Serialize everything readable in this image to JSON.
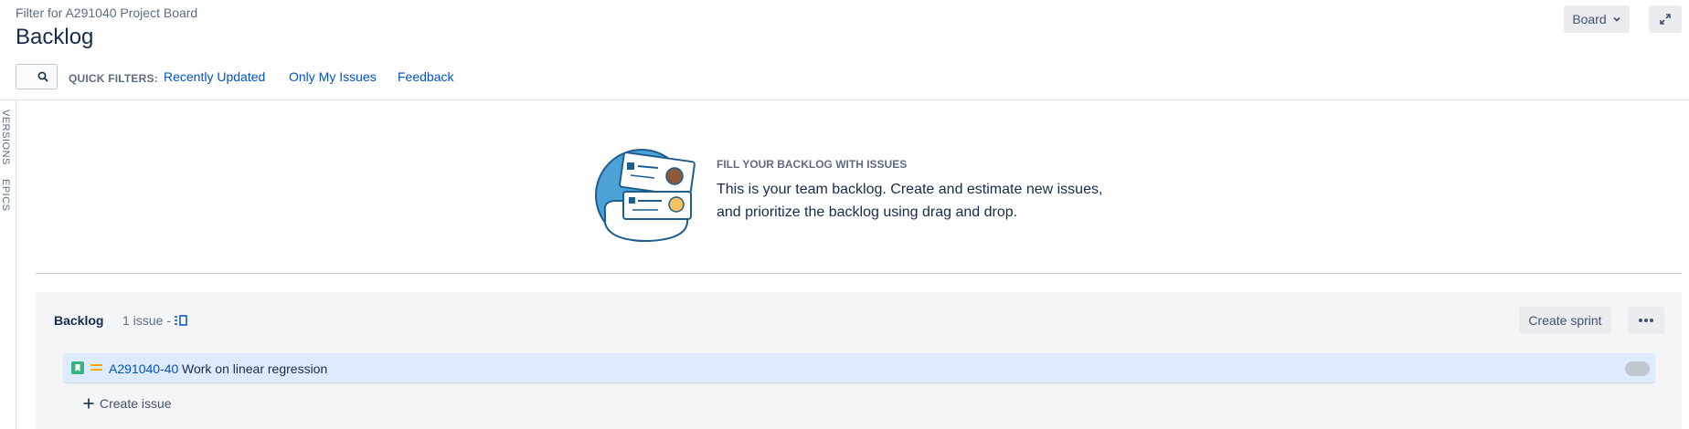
{
  "header": {
    "board_subtitle": "Filter for A291040 Project Board",
    "page_title": "Backlog",
    "board_button_label": "Board",
    "board_icon": "chevron-down-icon",
    "expand_icon": "expand-icon"
  },
  "quick_filters": {
    "label": "QUICK FILTERS:",
    "items": [
      "Recently Updated",
      "Only My Issues",
      "Feedback"
    ],
    "search_icon": "search-icon"
  },
  "side_tabs": [
    "VERSIONS",
    "EPICS"
  ],
  "empty_state": {
    "heading": "FILL YOUR BACKLOG WITH ISSUES",
    "line1": "This is your team backlog. Create and estimate new issues,",
    "line2": "and prioritize the backlog using drag and drop."
  },
  "backlog": {
    "title": "Backlog",
    "count": "1 issue",
    "separator": "-",
    "create_sprint_label": "Create sprint",
    "more_icon": "more-icon",
    "issues": [
      {
        "key": "A291040-40",
        "summary": "Work on linear regression",
        "type_icon": "story-icon",
        "priority_icon": "priority-medium-icon",
        "type_color": "#36b37e",
        "priority_color": "#ffab00"
      }
    ],
    "create_issue_label": "Create issue"
  },
  "colors": {
    "accent_link": "#0052cc",
    "row_highlight": "#deebff"
  }
}
